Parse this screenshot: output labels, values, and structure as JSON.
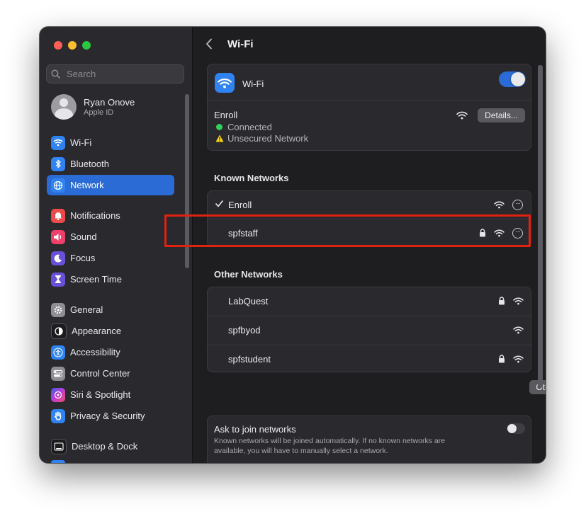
{
  "window": {
    "traffic_colors": [
      "#ff5f57",
      "#febc2e",
      "#28c840"
    ]
  },
  "sidebar": {
    "search_placeholder": "Search",
    "profile": {
      "name": "Ryan Onove",
      "subtitle": "Apple ID"
    },
    "items": [
      {
        "label": "Wi-Fi",
        "icon": "wifi-icon",
        "color": "#2f83f3",
        "active": false
      },
      {
        "label": "Bluetooth",
        "icon": "bluetooth-icon",
        "color": "#2f83f3",
        "active": false
      },
      {
        "label": "Network",
        "icon": "globe-icon",
        "color": "#2f83f3",
        "active": true
      },
      {
        "label": "Notifications",
        "icon": "bell-icon",
        "color": "#ef4a4a",
        "active": false
      },
      {
        "label": "Sound",
        "icon": "speaker-icon",
        "color": "#ef3f6a",
        "active": false
      },
      {
        "label": "Focus",
        "icon": "moon-icon",
        "color": "#6a4fd8",
        "active": false
      },
      {
        "label": "Screen Time",
        "icon": "hourglass-icon",
        "color": "#6a4fd8",
        "active": false
      },
      {
        "label": "General",
        "icon": "gear-icon",
        "color": "#8e8e93",
        "active": false
      },
      {
        "label": "Appearance",
        "icon": "appearance-icon",
        "color": "#1c1c1e",
        "active": false
      },
      {
        "label": "Accessibility",
        "icon": "accessibility-icon",
        "color": "#2f83f3",
        "active": false
      },
      {
        "label": "Control Center",
        "icon": "control-center-icon",
        "color": "#8e8e93",
        "active": false
      },
      {
        "label": "Siri & Spotlight",
        "icon": "siri-icon",
        "color": "#c13cd6",
        "active": false
      },
      {
        "label": "Privacy & Security",
        "icon": "hand-icon",
        "color": "#2f83f3",
        "active": false
      },
      {
        "label": "Desktop & Dock",
        "icon": "dock-icon",
        "color": "#1c1c1e",
        "active": false
      }
    ]
  },
  "main": {
    "title": "Wi-Fi",
    "wifi": {
      "label": "Wi-Fi",
      "toggle_on": true,
      "current_network": "Enroll",
      "status": "Connected",
      "warning": "Unsecured Network",
      "details_button": "Details..."
    },
    "known_networks": {
      "heading": "Known Networks",
      "items": [
        {
          "name": "Enroll",
          "checked": true,
          "locked": false
        },
        {
          "name": "spfstaff",
          "checked": false,
          "locked": true
        }
      ]
    },
    "other_networks": {
      "heading": "Other Networks",
      "items": [
        {
          "name": "LabQuest",
          "locked": true
        },
        {
          "name": "spfbyod",
          "locked": false
        },
        {
          "name": "spfstudent",
          "locked": true
        }
      ],
      "other_button": "Other..."
    },
    "ask_to_join": {
      "label": "Ask to join networks",
      "description_line1": "Known networks will be joined automatically. If no known networks are",
      "description_line2": "available, you will have to manually select a network.",
      "toggle_on": false
    }
  },
  "colors": {
    "accent": "#2a6bd6",
    "connected": "#30d158",
    "highlight": "#e0220f"
  }
}
